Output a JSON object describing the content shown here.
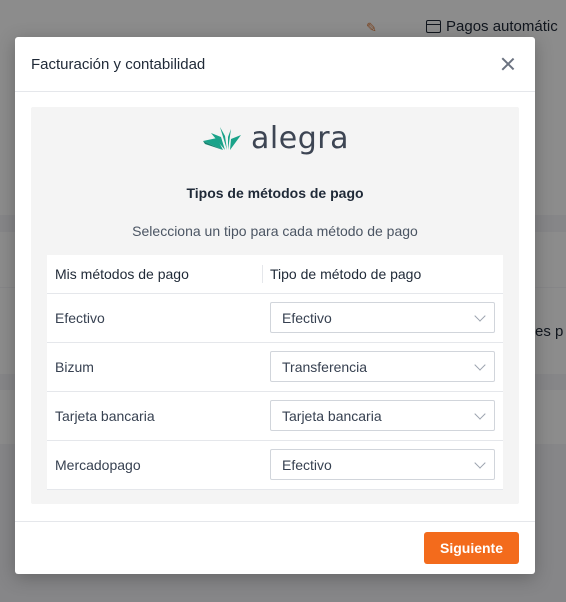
{
  "background": {
    "top_right_label": "Pagos automátic",
    "side_text": "es p"
  },
  "modal": {
    "title": "Facturación y contabilidad",
    "logo_text": "alegra",
    "section_title": "Tipos de métodos de pago",
    "section_subtitle": "Selecciona un tipo para cada método de pago",
    "table": {
      "headers": [
        "Mis métodos de pago",
        "Tipo de método de pago"
      ],
      "rows": [
        {
          "method": "Efectivo",
          "type": "Efectivo"
        },
        {
          "method": "Bizum",
          "type": "Transferencia"
        },
        {
          "method": "Tarjeta bancaria",
          "type": "Tarjeta bancaria"
        },
        {
          "method": "Mercadopago",
          "type": "Efectivo"
        }
      ]
    },
    "next_label": "Siguiente"
  },
  "colors": {
    "accent": "#f36b1c",
    "logo_green": "#1aa38a"
  }
}
